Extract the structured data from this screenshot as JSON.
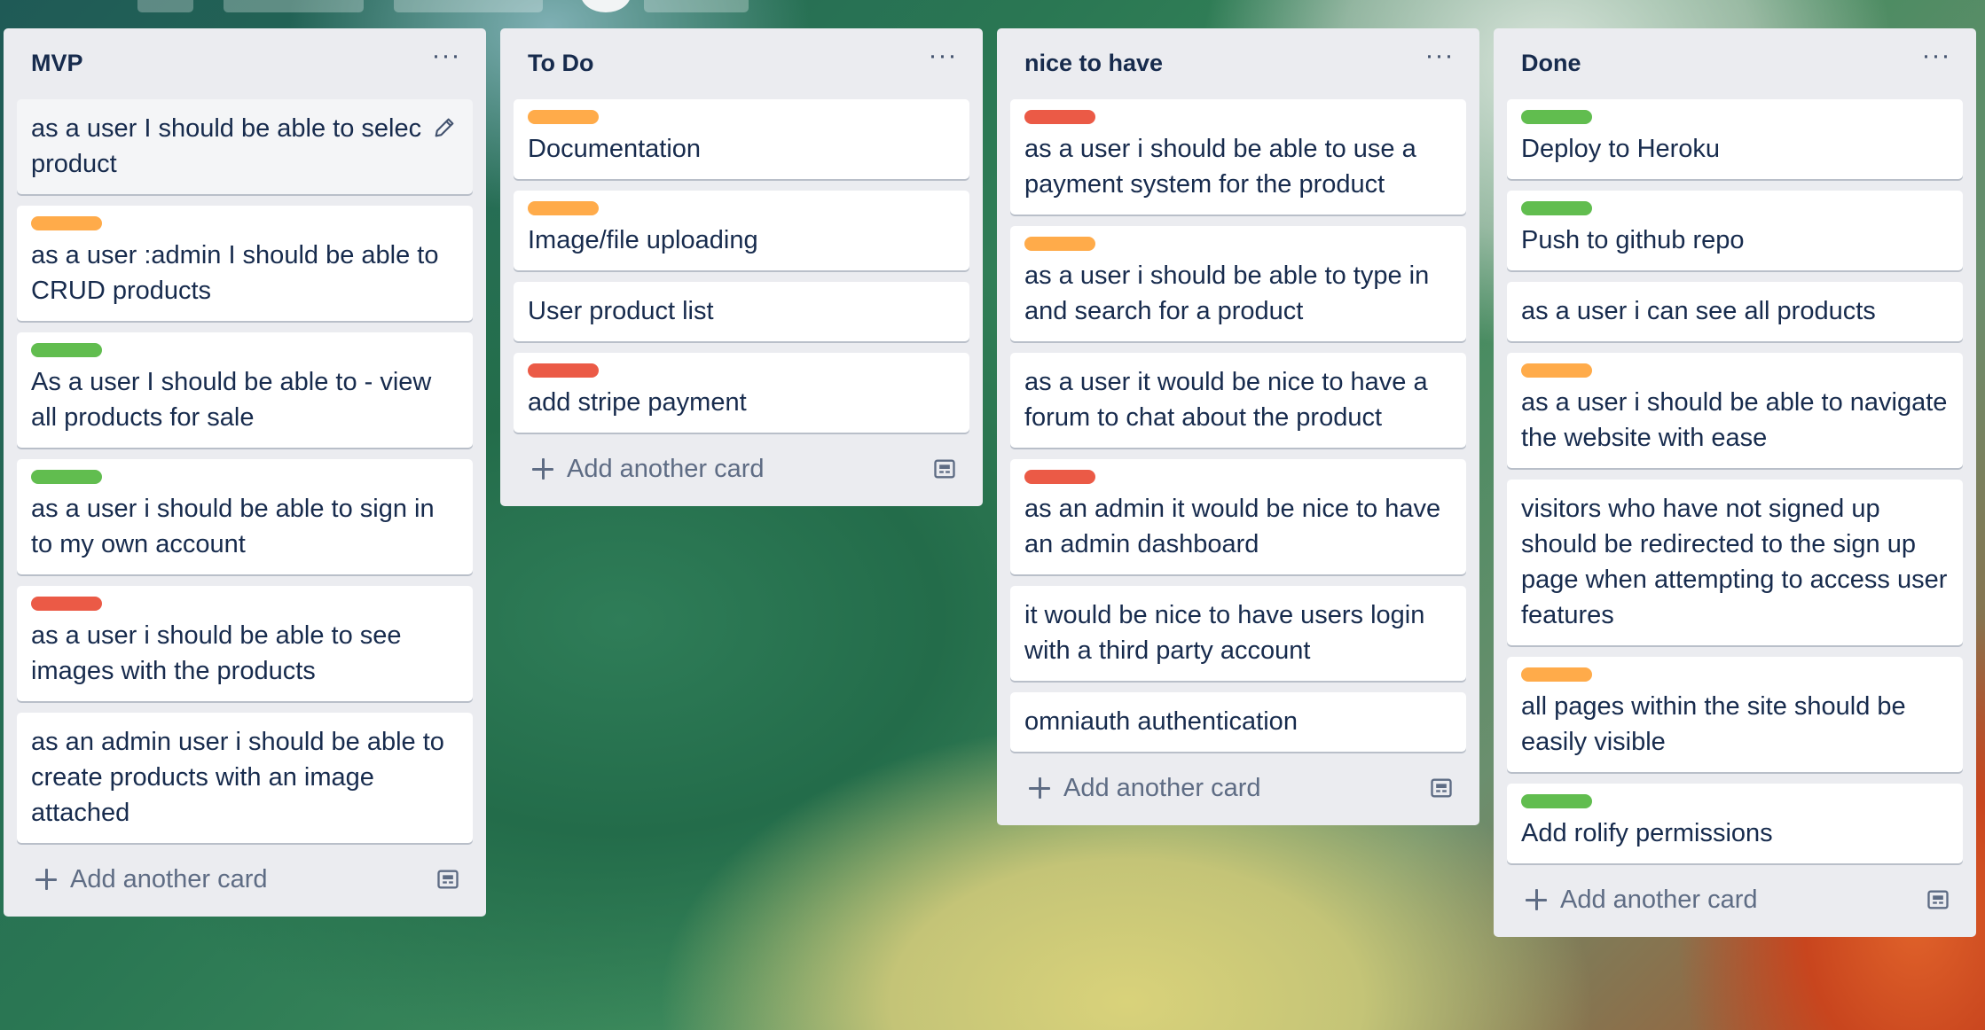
{
  "board": {
    "lists": [
      {
        "title": "MVP",
        "menu_icon": "ellipsis-icon",
        "cards": [
          {
            "label": null,
            "text": "as a user I should be able to select a product",
            "line1": "as a user I should be able to selec",
            "line2": "product",
            "hovered": true
          },
          {
            "label": "orange",
            "text": "as a user :admin I should be able to CRUD products"
          },
          {
            "label": "green",
            "text": "As a user I should be able to - view all products for sale"
          },
          {
            "label": "green",
            "text": "as a user i should be able to sign in to my own account"
          },
          {
            "label": "red",
            "text": "as a user i should be able to see images with the products"
          },
          {
            "label": null,
            "text": "as an admin user i should be able to create products with an image attached"
          }
        ],
        "add_card": "Add another card"
      },
      {
        "title": "To Do",
        "menu_icon": "ellipsis-icon",
        "cards": [
          {
            "label": "orange",
            "text": "Documentation"
          },
          {
            "label": "orange",
            "text": "Image/file uploading"
          },
          {
            "label": null,
            "text": "User product list"
          },
          {
            "label": "red",
            "text": "add stripe payment"
          }
        ],
        "add_card": "Add another card"
      },
      {
        "title": "nice to have",
        "menu_icon": "ellipsis-icon",
        "cards": [
          {
            "label": "red",
            "text": "as a user i should be able to use a payment system for the product"
          },
          {
            "label": "orange",
            "text": "as a user i should be able to type in and search for a product"
          },
          {
            "label": null,
            "text": "as a user it would be nice to have a forum to chat about the product"
          },
          {
            "label": "red",
            "text": "as an admin it would be nice to have an admin dashboard"
          },
          {
            "label": null,
            "text": "it would be nice to have users login with a third party account"
          },
          {
            "label": null,
            "text": "omniauth authentication"
          }
        ],
        "add_card": "Add another card"
      },
      {
        "title": "Done",
        "menu_icon": "ellipsis-icon",
        "cards": [
          {
            "label": "green",
            "text": "Deploy to Heroku"
          },
          {
            "label": "green",
            "text": "Push to github repo"
          },
          {
            "label": null,
            "text": "as a user i can see all products"
          },
          {
            "label": "orange",
            "text": "as a user i should be able to navigate the website with ease"
          },
          {
            "label": null,
            "text": "visitors who have not signed up should be redirected to the sign up page when attempting to access user features"
          },
          {
            "label": "orange",
            "text": "all pages within the site should be easily visible"
          },
          {
            "label": "green",
            "text": "Add rolify permissions"
          }
        ],
        "add_card": "Add another card"
      }
    ]
  },
  "label_colors": {
    "orange": "#ffab4a",
    "green": "#61bd4f",
    "red": "#eb5a46"
  }
}
